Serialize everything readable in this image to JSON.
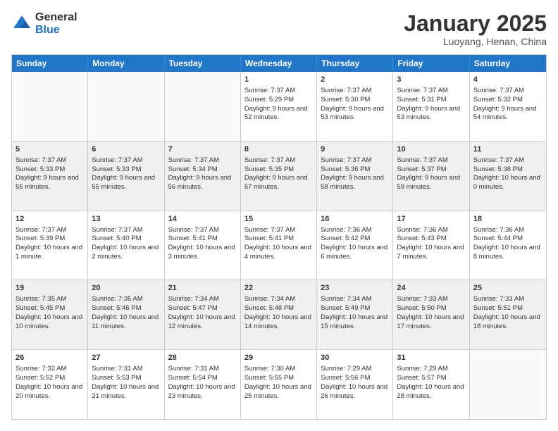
{
  "logo": {
    "general": "General",
    "blue": "Blue"
  },
  "title": "January 2025",
  "location": "Luoyang, Henan, China",
  "days": [
    "Sunday",
    "Monday",
    "Tuesday",
    "Wednesday",
    "Thursday",
    "Friday",
    "Saturday"
  ],
  "weeks": [
    [
      {
        "day": "",
        "info": ""
      },
      {
        "day": "",
        "info": ""
      },
      {
        "day": "",
        "info": ""
      },
      {
        "day": "1",
        "info": "Sunrise: 7:37 AM\nSunset: 5:29 PM\nDaylight: 9 hours and 52 minutes."
      },
      {
        "day": "2",
        "info": "Sunrise: 7:37 AM\nSunset: 5:30 PM\nDaylight: 9 hours and 53 minutes."
      },
      {
        "day": "3",
        "info": "Sunrise: 7:37 AM\nSunset: 5:31 PM\nDaylight: 9 hours and 53 minutes."
      },
      {
        "day": "4",
        "info": "Sunrise: 7:37 AM\nSunset: 5:32 PM\nDaylight: 9 hours and 54 minutes."
      }
    ],
    [
      {
        "day": "5",
        "info": "Sunrise: 7:37 AM\nSunset: 5:33 PM\nDaylight: 9 hours and 55 minutes."
      },
      {
        "day": "6",
        "info": "Sunrise: 7:37 AM\nSunset: 5:33 PM\nDaylight: 9 hours and 55 minutes."
      },
      {
        "day": "7",
        "info": "Sunrise: 7:37 AM\nSunset: 5:34 PM\nDaylight: 9 hours and 56 minutes."
      },
      {
        "day": "8",
        "info": "Sunrise: 7:37 AM\nSunset: 5:35 PM\nDaylight: 9 hours and 57 minutes."
      },
      {
        "day": "9",
        "info": "Sunrise: 7:37 AM\nSunset: 5:36 PM\nDaylight: 9 hours and 58 minutes."
      },
      {
        "day": "10",
        "info": "Sunrise: 7:37 AM\nSunset: 5:37 PM\nDaylight: 9 hours and 59 minutes."
      },
      {
        "day": "11",
        "info": "Sunrise: 7:37 AM\nSunset: 5:38 PM\nDaylight: 10 hours and 0 minutes."
      }
    ],
    [
      {
        "day": "12",
        "info": "Sunrise: 7:37 AM\nSunset: 5:39 PM\nDaylight: 10 hours and 1 minute."
      },
      {
        "day": "13",
        "info": "Sunrise: 7:37 AM\nSunset: 5:40 PM\nDaylight: 10 hours and 2 minutes."
      },
      {
        "day": "14",
        "info": "Sunrise: 7:37 AM\nSunset: 5:41 PM\nDaylight: 10 hours and 3 minutes."
      },
      {
        "day": "15",
        "info": "Sunrise: 7:37 AM\nSunset: 5:41 PM\nDaylight: 10 hours and 4 minutes."
      },
      {
        "day": "16",
        "info": "Sunrise: 7:36 AM\nSunset: 5:42 PM\nDaylight: 10 hours and 6 minutes."
      },
      {
        "day": "17",
        "info": "Sunrise: 7:36 AM\nSunset: 5:43 PM\nDaylight: 10 hours and 7 minutes."
      },
      {
        "day": "18",
        "info": "Sunrise: 7:36 AM\nSunset: 5:44 PM\nDaylight: 10 hours and 8 minutes."
      }
    ],
    [
      {
        "day": "19",
        "info": "Sunrise: 7:35 AM\nSunset: 5:45 PM\nDaylight: 10 hours and 10 minutes."
      },
      {
        "day": "20",
        "info": "Sunrise: 7:35 AM\nSunset: 5:46 PM\nDaylight: 10 hours and 11 minutes."
      },
      {
        "day": "21",
        "info": "Sunrise: 7:34 AM\nSunset: 5:47 PM\nDaylight: 10 hours and 12 minutes."
      },
      {
        "day": "22",
        "info": "Sunrise: 7:34 AM\nSunset: 5:48 PM\nDaylight: 10 hours and 14 minutes."
      },
      {
        "day": "23",
        "info": "Sunrise: 7:34 AM\nSunset: 5:49 PM\nDaylight: 10 hours and 15 minutes."
      },
      {
        "day": "24",
        "info": "Sunrise: 7:33 AM\nSunset: 5:50 PM\nDaylight: 10 hours and 17 minutes."
      },
      {
        "day": "25",
        "info": "Sunrise: 7:33 AM\nSunset: 5:51 PM\nDaylight: 10 hours and 18 minutes."
      }
    ],
    [
      {
        "day": "26",
        "info": "Sunrise: 7:32 AM\nSunset: 5:52 PM\nDaylight: 10 hours and 20 minutes."
      },
      {
        "day": "27",
        "info": "Sunrise: 7:31 AM\nSunset: 5:53 PM\nDaylight: 10 hours and 21 minutes."
      },
      {
        "day": "28",
        "info": "Sunrise: 7:31 AM\nSunset: 5:54 PM\nDaylight: 10 hours and 23 minutes."
      },
      {
        "day": "29",
        "info": "Sunrise: 7:30 AM\nSunset: 5:55 PM\nDaylight: 10 hours and 25 minutes."
      },
      {
        "day": "30",
        "info": "Sunrise: 7:29 AM\nSunset: 5:56 PM\nDaylight: 10 hours and 26 minutes."
      },
      {
        "day": "31",
        "info": "Sunrise: 7:29 AM\nSunset: 5:57 PM\nDaylight: 10 hours and 28 minutes."
      },
      {
        "day": "",
        "info": ""
      }
    ]
  ]
}
